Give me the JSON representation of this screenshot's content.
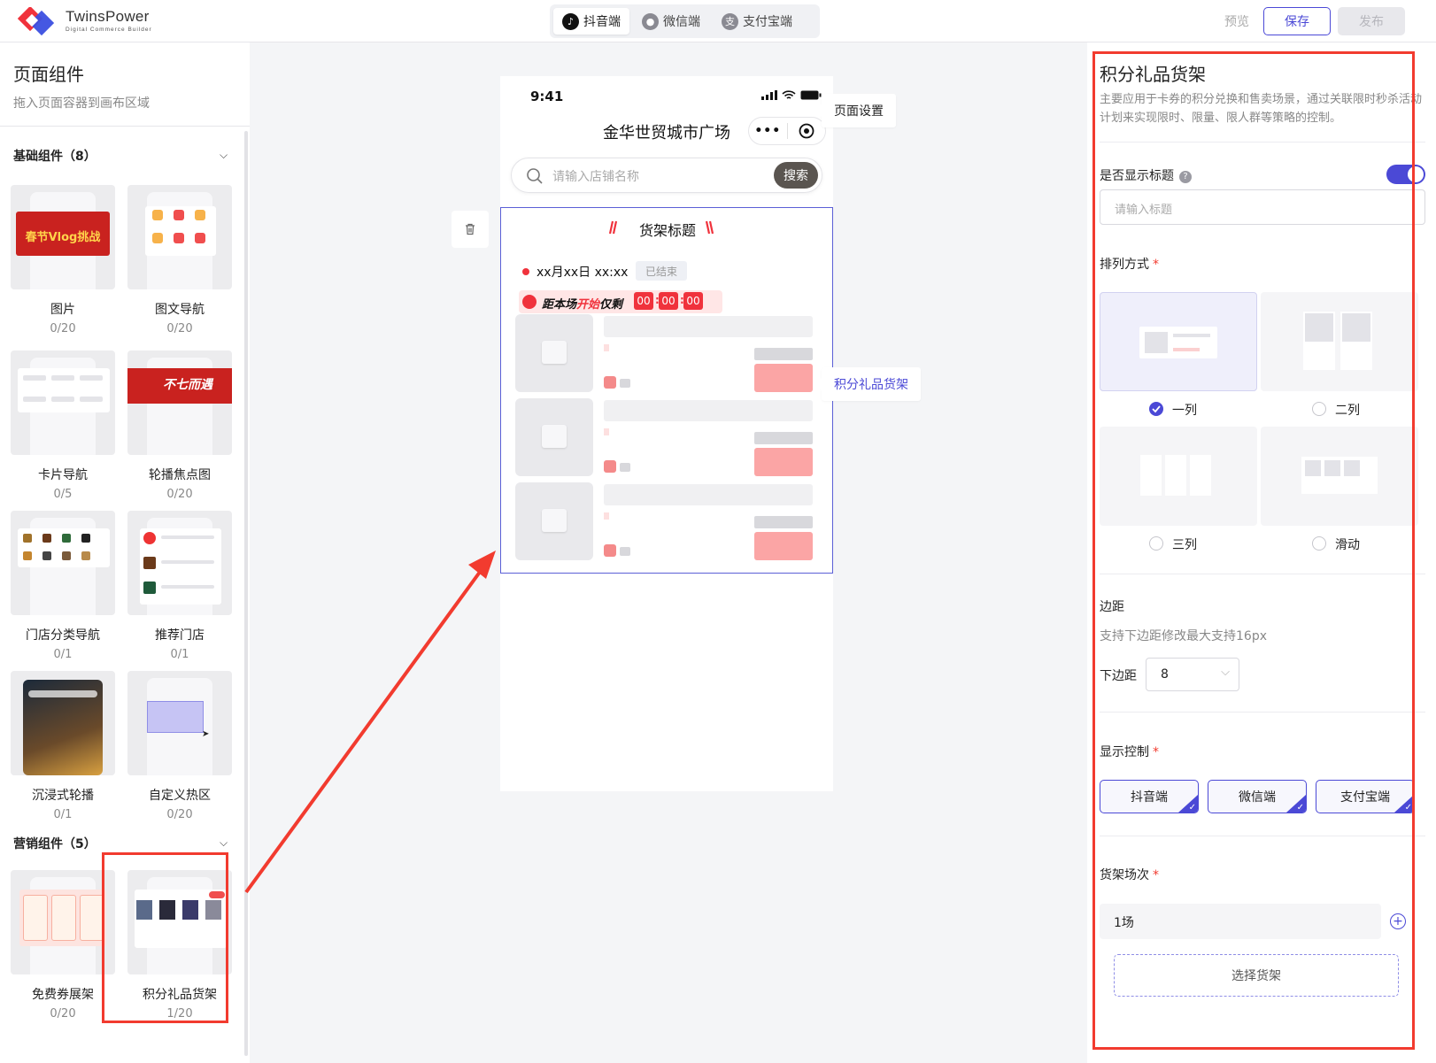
{
  "app": {
    "brand_name": "TwinsPower",
    "brand_sub": "Digital Commerce Builder",
    "tabs": [
      {
        "label": "抖音端",
        "icon": "douyin-icon",
        "active": true
      },
      {
        "label": "微信端",
        "icon": "wechat-icon",
        "active": false
      },
      {
        "label": "支付宝端",
        "icon": "alipay-icon",
        "active": false
      }
    ],
    "preview_label": "预览",
    "save_label": "保存",
    "publish_label": "发布",
    "accent": "#4b49d6",
    "highlight_color": "#f23b2f"
  },
  "left": {
    "title": "页面组件",
    "subtitle": "拖入页面容器到画布区域",
    "groups": [
      {
        "title": "基础组件（8）",
        "items": [
          {
            "name": "图片",
            "count": "0/20",
            "thumb_caption": "春节Vlog挑战"
          },
          {
            "name": "图文导航",
            "count": "0/20"
          },
          {
            "name": "卡片导航",
            "count": "0/5"
          },
          {
            "name": "轮播焦点图",
            "count": "0/20",
            "thumb_caption": "不七而遇"
          },
          {
            "name": "门店分类导航",
            "count": "0/1"
          },
          {
            "name": "推荐门店",
            "count": "0/1"
          },
          {
            "name": "沉浸式轮播",
            "count": "0/1"
          },
          {
            "name": "自定义热区",
            "count": "0/20"
          }
        ]
      },
      {
        "title": "营销组件（5）",
        "items": [
          {
            "name": "免费券展架",
            "count": "0/20"
          },
          {
            "name": "积分礼品货架",
            "count": "1/20"
          }
        ]
      }
    ]
  },
  "canvas": {
    "status_time": "9:41",
    "mall_title": "金华世贸城市广场",
    "search_placeholder": "请输入店铺名称",
    "search_button": "搜索",
    "shelf_title": "货架标题",
    "session_time": "xx月xx日  xx:xx",
    "session_status": "已结束",
    "countdown_prefix": "距本场",
    "countdown_highlight": "开始",
    "countdown_suffix": "仅剩",
    "countdown_values": [
      "00",
      "00",
      "00"
    ],
    "callout_page": "页面设置",
    "callout_shelf": "积分礼品货架"
  },
  "right": {
    "title": "积分礼品货架",
    "description": "主要应用于卡券的积分兑换和售卖场景，通过关联限时秒杀活动计划来实现限时、限量、限人群等策略的控制。",
    "show_title_label": "是否显示标题",
    "show_title_on": true,
    "title_placeholder": "请输入标题",
    "layout_label": "排列方式",
    "layout_options": [
      {
        "label": "一列",
        "checked": true
      },
      {
        "label": "二列",
        "checked": false
      },
      {
        "label": "三列",
        "checked": false
      },
      {
        "label": "滑动",
        "checked": false
      }
    ],
    "margin_label": "边距",
    "margin_note": "支持下边距修改最大支持16px",
    "bottom_margin_label": "下边距",
    "bottom_margin_value": "8",
    "display_label": "显示控制",
    "display_platforms": [
      "抖音端",
      "微信端",
      "支付宝端"
    ],
    "session_label": "货架场次",
    "session_value": "1场",
    "choose_shelf": "选择货架"
  }
}
